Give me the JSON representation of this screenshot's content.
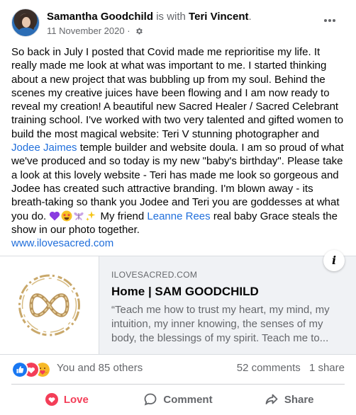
{
  "post": {
    "author": "Samantha Goodchild",
    "with_text": "is with",
    "tagged": "Teri Vincent",
    "tagged_suffix": ".",
    "date": "11 November 2020",
    "dot": "·",
    "privacy_icon": "gear-icon",
    "body_1": "So back in July I posted that Covid made me reprioritise my life. It really made me look at what was important to me. I started thinking about a new project that was bubbling up from my soul. Behind the scenes my creative juices have been flowing and I am now ready to reveal my creation! A beautiful new Sacred Healer / Sacred Celebrant training school. I've worked with two very talented and gifted women to build the most magical website: Teri V stunning photographer and ",
    "mention_1": "Jodee Jaimes",
    "body_2": " temple builder and website doula. I am so proud of what we've produced and so today is my new \"baby's birthday\". Please take a look at this lovely website - Teri has made me look so gorgeous and Jodee has created such attractive branding.  I'm blown away - its breath-taking so thank you Jodee and Teri you are goddesses at what you do. ",
    "emojis": [
      "purple-heart",
      "star-struck",
      "butterfly",
      "sparkles"
    ],
    "body_3": " My friend ",
    "mention_2": "Leanne Rees",
    "body_4": " real baby Grace steals the show in our photo together.",
    "link": "www.ilovesacred.com"
  },
  "preview": {
    "domain": "ILOVESACRED.COM",
    "title": "Home | SAM GOODCHILD",
    "description": "“Teach me how to trust my heart, my mind, my intuition, my inner knowing, the senses of my body, the blessings of my spirit. Teach me to...",
    "info_label": "i"
  },
  "reactions": {
    "icons": [
      "like",
      "love",
      "care"
    ],
    "summary": "You and 85 others",
    "comments": "52 comments",
    "shares": "1 share"
  },
  "actions": {
    "love": "Love",
    "comment": "Comment",
    "share": "Share"
  },
  "colors": {
    "link": "#216fdb",
    "love": "#f33e58",
    "muted": "#65676b",
    "preview_bg": "#f0f2f5"
  }
}
